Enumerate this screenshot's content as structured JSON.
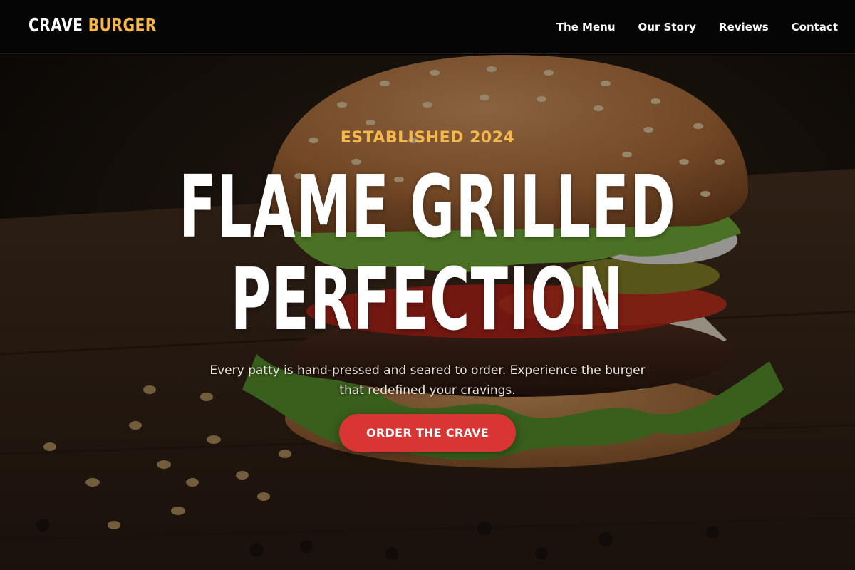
{
  "header": {
    "logo": {
      "first": "CRAVE",
      "second": "BURGER"
    },
    "nav": [
      {
        "label": "The Menu"
      },
      {
        "label": "Our Story"
      },
      {
        "label": "Reviews"
      },
      {
        "label": "Contact"
      }
    ]
  },
  "hero": {
    "eyebrow": "ESTABLISHED 2024",
    "headline": [
      "FLAME GRILLED",
      "PERFECTION"
    ],
    "subtext": "Every patty is hand-pressed and seared to order. Experience the burger that redefined your cravings.",
    "cta_label": "ORDER THE CRAVE"
  },
  "colors": {
    "accent": "#f5b74a",
    "cta": "#d93535",
    "header_bg": "#050505",
    "text": "#ffffff"
  },
  "icons": [
    "burger-photo"
  ]
}
